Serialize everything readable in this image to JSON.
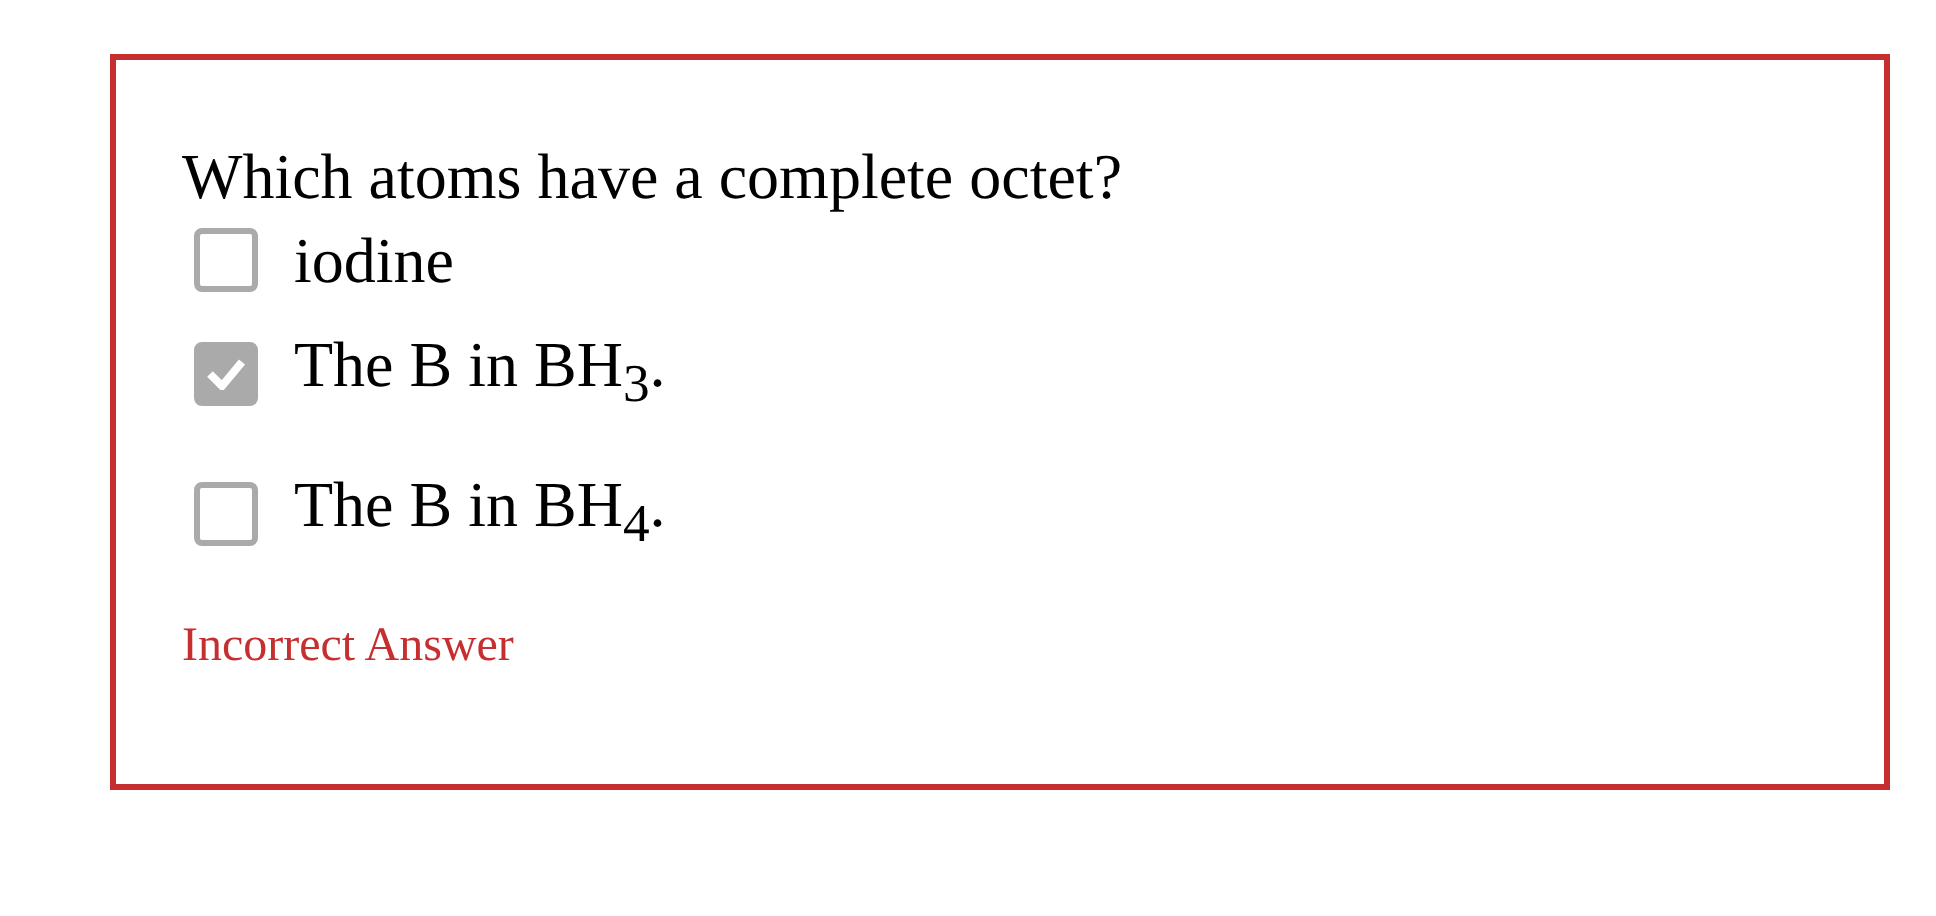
{
  "question": "Which atoms have a complete octet?",
  "options": [
    {
      "label": "iodine",
      "checked": false
    },
    {
      "label": "The B in BH$_{3}$.",
      "checked": true
    },
    {
      "label": "The B in BH$_{4}$.",
      "checked": false
    }
  ],
  "feedback": "Incorrect Answer"
}
